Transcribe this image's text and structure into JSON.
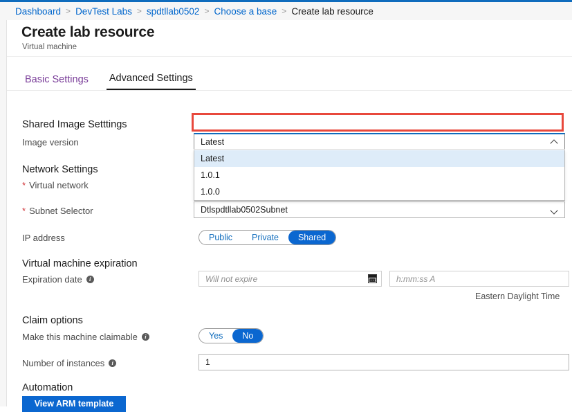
{
  "breadcrumb": {
    "items": [
      {
        "label": "Dashboard",
        "current": false
      },
      {
        "label": "DevTest Labs",
        "current": false
      },
      {
        "label": "spdtllab0502",
        "current": false
      },
      {
        "label": "Choose a base",
        "current": false
      },
      {
        "label": "Create lab resource",
        "current": true
      }
    ],
    "separator": ">"
  },
  "header": {
    "title": "Create lab resource",
    "subtitle": "Virtual machine"
  },
  "tabs": [
    {
      "label": "Basic Settings",
      "active": false
    },
    {
      "label": "Advanced Settings",
      "active": true
    }
  ],
  "sections": {
    "shared_image": {
      "heading": "Shared Image Setttings",
      "image_version": {
        "label": "Image version",
        "value": "Latest",
        "expanded": true,
        "chevron": "chevron-up-icon",
        "options": [
          {
            "label": "Latest",
            "selected": true
          },
          {
            "label": "1.0.1",
            "selected": false
          },
          {
            "label": "1.0.0",
            "selected": false
          }
        ]
      }
    },
    "network": {
      "heading": "Network Settings",
      "virtual_network": {
        "label": "Virtual network",
        "required": true,
        "required_marker": "*"
      },
      "subnet_selector": {
        "label": "Subnet Selector",
        "required": true,
        "required_marker": "*",
        "value": "Dtlspdtllab0502Subnet",
        "chevron": "chevron-down-icon"
      },
      "ip_address": {
        "label": "IP address",
        "options": [
          {
            "label": "Public",
            "selected": false
          },
          {
            "label": "Private",
            "selected": false
          },
          {
            "label": "Shared",
            "selected": true
          }
        ]
      }
    },
    "expiration": {
      "heading": "Virtual machine expiration",
      "expiration_date": {
        "label": "Expiration date",
        "info": "info-icon",
        "date_placeholder": "Will not expire",
        "date_value": "",
        "time_placeholder": "h:mm:ss A",
        "time_value": ""
      },
      "timezone_note": "Eastern Daylight Time"
    },
    "claim": {
      "heading": "Claim options",
      "claimable": {
        "label": "Make this machine claimable",
        "info": "info-icon",
        "options": [
          {
            "label": "Yes",
            "selected": false
          },
          {
            "label": "No",
            "selected": true
          }
        ]
      },
      "instances": {
        "label": "Number of instances",
        "info": "info-icon",
        "value": "1"
      }
    },
    "automation": {
      "heading": "Automation",
      "view_arm_template_button": "View ARM template"
    }
  },
  "annotation": {
    "type": "highlight-rectangle",
    "color": "#e8483c",
    "target": "image-version-combobox"
  },
  "colors": {
    "accent_blue": "#0b67d0",
    "link_blue": "#0066cc",
    "tab_inactive_purple": "#7a3d99",
    "required_red": "#d13438",
    "option_highlight": "#deecf9",
    "annotation_red": "#e8483c"
  }
}
